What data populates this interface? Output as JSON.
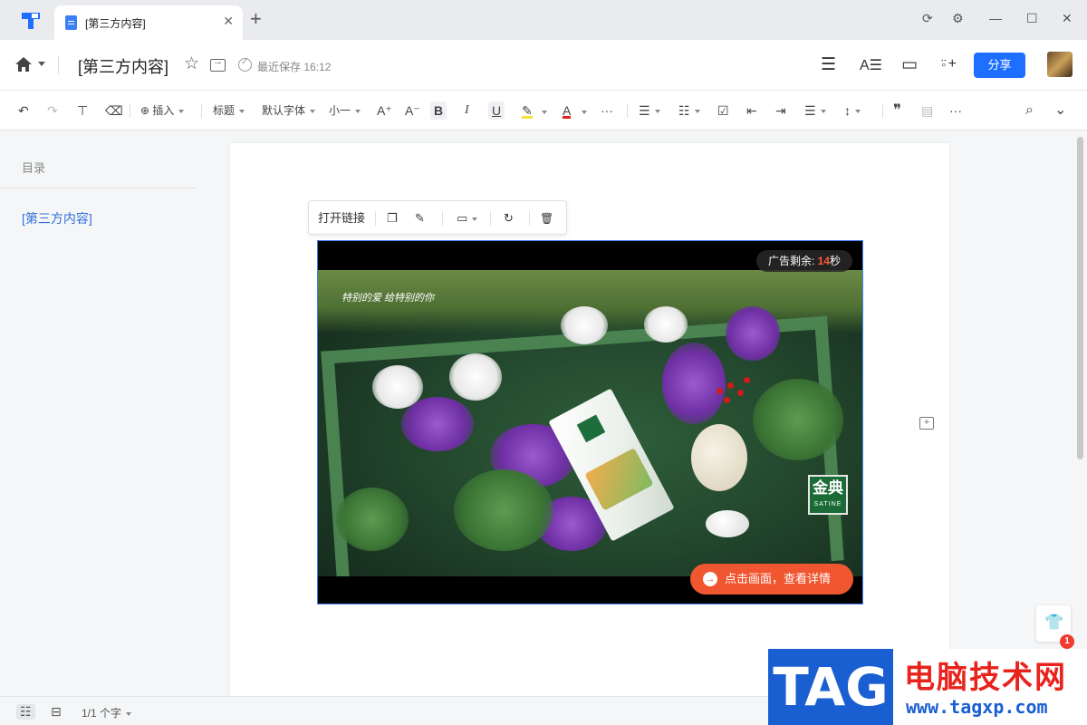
{
  "tab": {
    "title": "[第三方内容]",
    "close": "✕",
    "add": "+"
  },
  "window": {
    "sync": "⟳",
    "settings": "⚙",
    "minimize": "—",
    "maximize": "☐",
    "close": "✕"
  },
  "header": {
    "title": "[第三方内容]",
    "star": "☆",
    "save_status": "最近保存 16:12",
    "menu": "☰",
    "font_style": "A☰",
    "present": "▭",
    "add_collaborator": "⍤+",
    "share_label": "分享"
  },
  "toolbar": {
    "undo": "↶",
    "redo": "↷",
    "format_painter": "⊤",
    "eraser": "⌫",
    "insert": "⊕ 插入",
    "heading": "标题",
    "font": "默认字体",
    "size": "小一",
    "grow": "A⁺",
    "shrink": "A⁻",
    "bold": "B",
    "italic": "I",
    "underline": "U",
    "highlight": "✎",
    "font_color": "A",
    "more1": "···",
    "bullet": "☰",
    "numbered": "☷",
    "checklist": "☑",
    "outdent": "⇤",
    "indent": "⇥",
    "align": "☰",
    "line_spacing": "↕",
    "quote": "❞",
    "divider": "▤",
    "more2": "···",
    "search": "⌕",
    "collapse": "⌄"
  },
  "outline": {
    "title": "目录",
    "items": [
      "[第三方内容]"
    ]
  },
  "float_toolbar": {
    "open_link": "打开链接",
    "copy": "❐",
    "edit": "✎",
    "display": "▭",
    "refresh": "↻",
    "delete": "🗑"
  },
  "embed": {
    "timer_prefix": "广告剩余: ",
    "timer_value": "14",
    "timer_suffix": "秒",
    "caption": "特别的爱 给特别的你",
    "brand_cn": "金典",
    "brand_en": "SATINE",
    "cta_icon": "→",
    "cta_label": "点击画面，查看详情"
  },
  "side": {
    "comment_add": "+"
  },
  "skin": {
    "icon": "👕",
    "badge": "1"
  },
  "statusbar": {
    "outline_view": "☷",
    "page_view": "⊟",
    "word_count": "1/1 个字"
  },
  "watermark": {
    "tag": "TAG",
    "cn": "电脑技术网",
    "url": "www.tagxp.com"
  },
  "colors": {
    "accent": "#1e6fff",
    "highlight": "#f4e23a",
    "font_color": "#e3251b",
    "cta": "#f05630",
    "link": "#2f6fdc"
  }
}
